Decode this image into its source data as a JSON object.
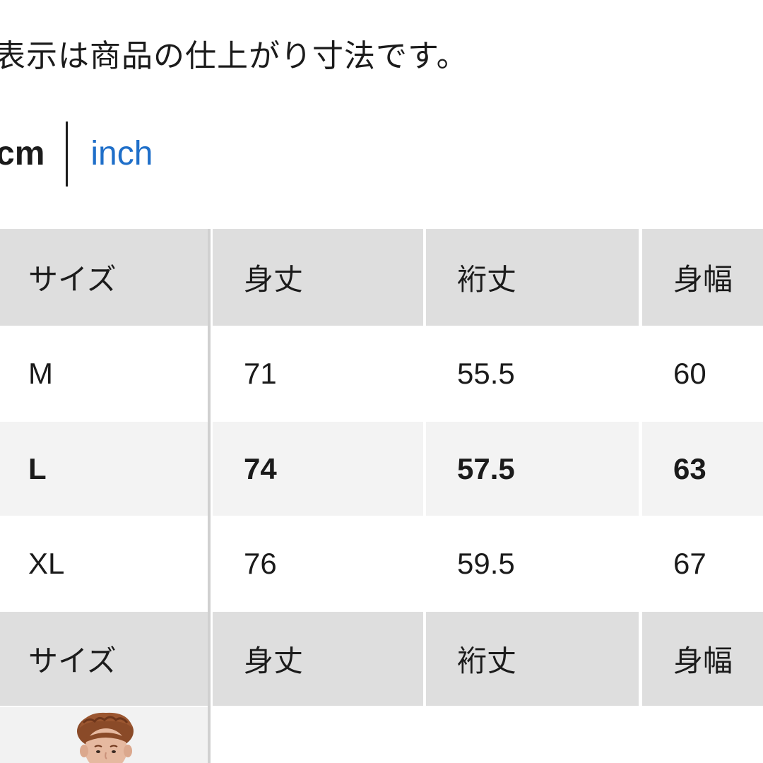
{
  "note": "表示は商品の仕上がり寸法です。",
  "units": {
    "active": "cm",
    "alternate": "inch"
  },
  "size_table": {
    "headers": [
      "サイズ",
      "身丈",
      "裄丈",
      "身幅"
    ],
    "rows": [
      [
        "M",
        "71",
        "55.5",
        "60"
      ],
      [
        "L",
        "74",
        "57.5",
        "63"
      ],
      [
        "XL",
        "76",
        "59.5",
        "67"
      ]
    ],
    "highlighted_row": "L",
    "footer_headers": [
      "サイズ",
      "身丈",
      "裄丈",
      "身幅"
    ]
  },
  "colors": {
    "header_bg": "#dedede",
    "highlight_bg": "#f3f3f3",
    "link": "#1f6fc9",
    "text": "#1b1b1b"
  }
}
